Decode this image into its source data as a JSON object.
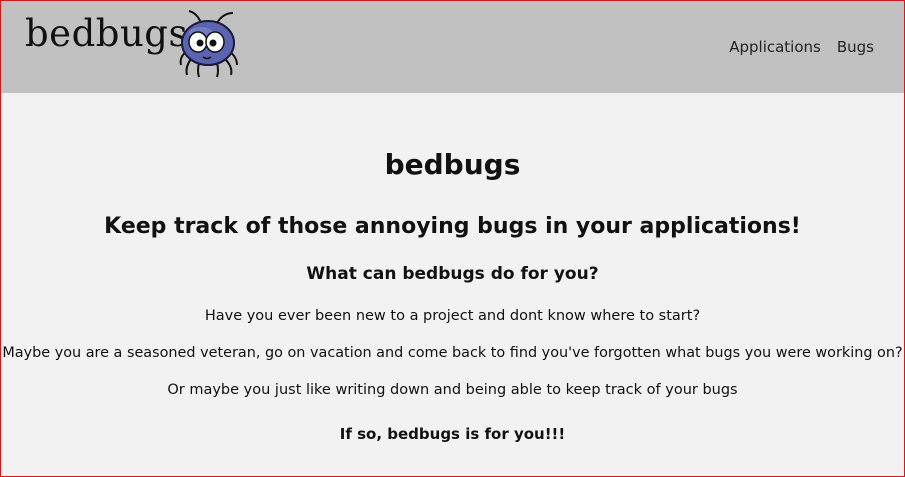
{
  "navbar": {
    "logo_text": "bedbugs",
    "links": [
      {
        "label": "Applications"
      },
      {
        "label": "Bugs"
      }
    ]
  },
  "main": {
    "title": "bedbugs",
    "subtitle": "Keep track of those annoying bugs in your applications!",
    "question": "What can bedbugs do for you?",
    "paragraphs": [
      "Have you ever been new to a project and dont know where to start?",
      "Maybe you are a seasoned veteran, go on vacation and come back to find you've forgotten what bugs you were working on?",
      "Or maybe you just like writing down and being able to keep track of your bugs"
    ],
    "closing": "If so, bedbugs is for you!!!"
  },
  "colors": {
    "navbar_bg": "#c1c1c1",
    "page_bg": "#f2f2f2",
    "bug_body": "#5a64b2",
    "frame_border": "#d01a1a"
  }
}
